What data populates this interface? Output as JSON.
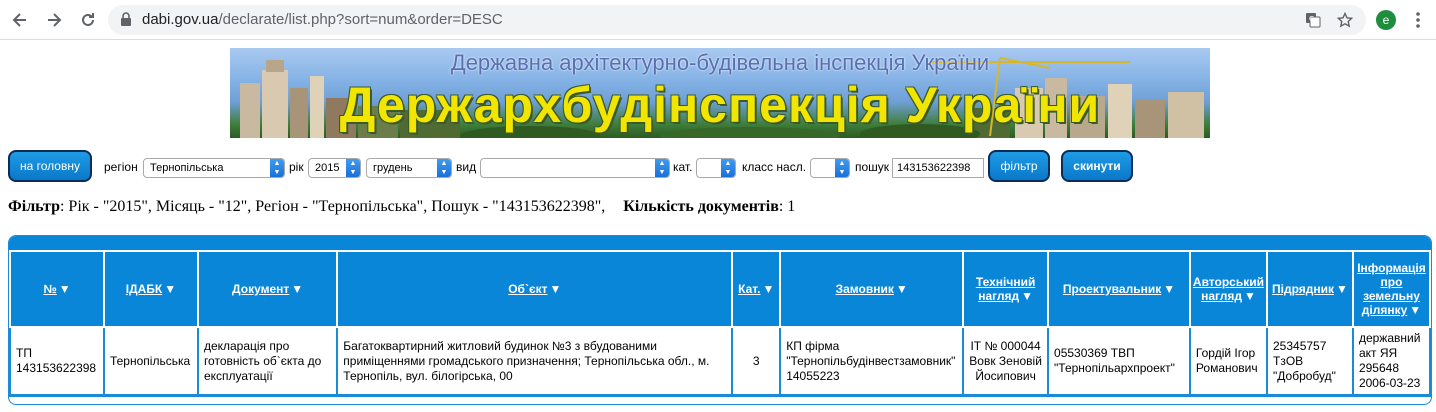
{
  "browser": {
    "url_host": "dabi.gov.ua",
    "url_path": "/declarate/list.php?sort=num&order=DESC",
    "profile_initial": "e"
  },
  "banner": {
    "subtitle": "Державна архітектурно-будівельна інспекція України",
    "title": "Держархбудінспекція України"
  },
  "toolbar": {
    "home_label": "на головну",
    "region_label": "регіон",
    "region_value": "Тернопільська",
    "year_label": "рік",
    "year_value": "2015",
    "month_value": "грудень",
    "type_label": "вид",
    "type_value": "",
    "cat_label": "кат.",
    "cat_value": "",
    "class_label": "класс насл.",
    "class_value": "",
    "search_label": "пошук",
    "search_value": "143153622398",
    "filter_label": "фільтр",
    "reset_label": "скинути"
  },
  "summary": {
    "filter_label": "Фільтр",
    "filter_text": ": Рік - \"2015\", Місяць - \"12\", Регіон - \"Тернопільська\", Пошук - \"143153622398\",",
    "count_label": "Кількість документів",
    "count_value": ": 1"
  },
  "table": {
    "headers": [
      {
        "label": "№"
      },
      {
        "label": "ІДАБК"
      },
      {
        "label": "Документ"
      },
      {
        "label": "Об`єкт"
      },
      {
        "label": "Кат."
      },
      {
        "label": "Замовник"
      },
      {
        "label": "Технічний нагляд"
      },
      {
        "label": "Проектувальник"
      },
      {
        "label": "Авторський нагляд"
      },
      {
        "label": "Підрядник"
      },
      {
        "label": "Інформація про земельну ділянку"
      }
    ],
    "rows": [
      [
        "ТП 143153622398",
        "Тернопільська",
        "декларація про готовність об`єкта до експлуатації",
        "Багатоквартирний житловий будинок №3 з вбудованими приміщеннями громадського призначення; Тернопільська обл., м. Тернопіль, вул. білогірська, 00",
        "3",
        "КП фірма \"Тернопільбудінвестзамовник\" 14055223",
        "ІТ № 000044 Вовк Зеновій Йосипович",
        "05530369 ТВП \"Тернопільархпроект\"",
        "Гордій Ігор Романович",
        "25345757 ТзОВ \"Добробуд\"",
        "державний акт ЯЯ 295648 2006-03-23"
      ]
    ]
  },
  "colors": {
    "header_blue": "#0a86d8",
    "button_blue": "#0a78c8",
    "banner_yellow": "#f2e600"
  }
}
